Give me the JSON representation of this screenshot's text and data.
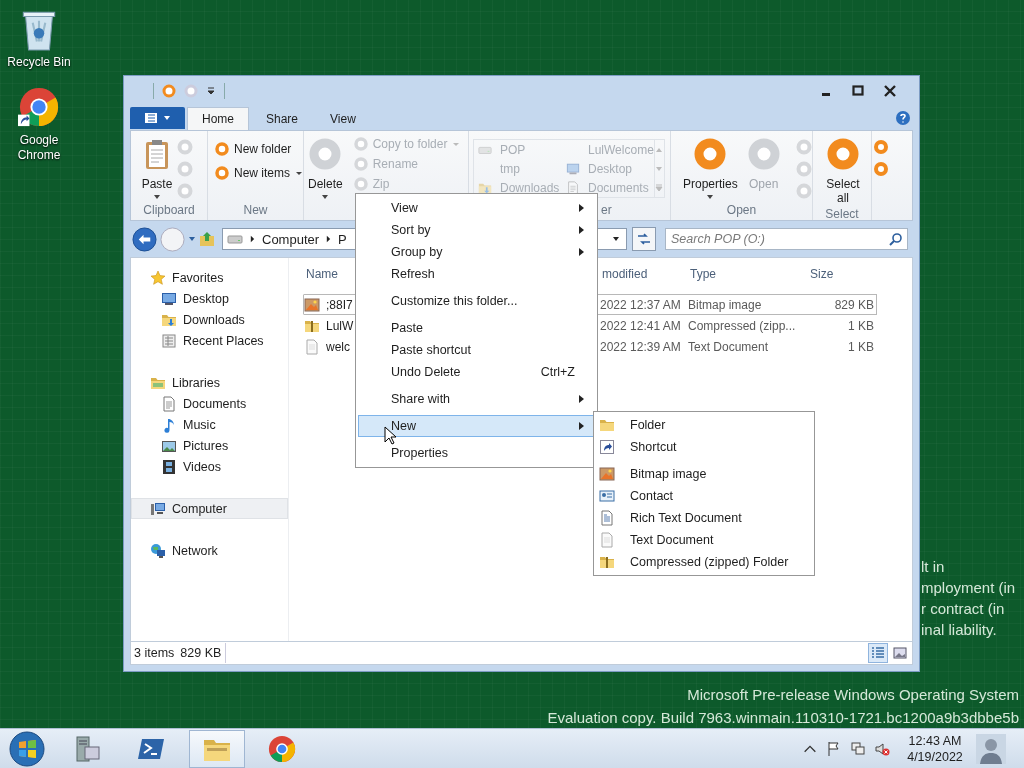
{
  "desktop": {
    "icons": [
      {
        "label": "Recycle Bin",
        "kind": "recycle"
      },
      {
        "label": "Google Chrome",
        "kind": "browser"
      }
    ],
    "notice_lines": [
      "lt in",
      "mployment (in",
      "r contract (in",
      "inal liability."
    ],
    "build_notice": [
      "Microsoft Pre-release Windows Operating System",
      "Evaluation copy. Build 7963.winmain.110310-1721.bc1200a9b3dbbe5b"
    ]
  },
  "explorer": {
    "ribbon_tabs": [
      {
        "label": "Home",
        "selected": true
      },
      {
        "label": "Share",
        "selected": false
      },
      {
        "label": "View",
        "selected": false
      }
    ],
    "ribbon": {
      "clipboard": {
        "label": "Clipboard",
        "button": "Paste"
      },
      "new": {
        "label": "New",
        "items": [
          {
            "label": "New folder",
            "dropdown": false
          },
          {
            "label": "New items",
            "dropdown": true
          }
        ]
      },
      "organize": {
        "button": "Delete",
        "items": [
          {
            "label": "Copy to folder",
            "dropdown": true,
            "disabled": true
          },
          {
            "label": "Rename",
            "dropdown": false,
            "disabled": true
          },
          {
            "label": "Zip",
            "dropdown": false,
            "disabled": true
          }
        ]
      },
      "gallery": {
        "label": "er",
        "items": [
          {
            "label": "POP",
            "kind": "drive"
          },
          {
            "label": "LulWelcome",
            "kind": "blank"
          },
          {
            "label": "tmp",
            "kind": "blank"
          },
          {
            "label": "Desktop",
            "kind": "desktop"
          },
          {
            "label": "Downloads",
            "kind": "downloads"
          },
          {
            "label": "Documents",
            "kind": "documents"
          }
        ]
      },
      "open": {
        "label": "Open",
        "buttons": [
          {
            "label": "Properties",
            "disabled": false,
            "dropdown": true
          },
          {
            "label": "Open",
            "disabled": true,
            "dropdown": false
          }
        ]
      },
      "select": {
        "label": "Select",
        "button": "Select all"
      }
    },
    "address": {
      "crumbs": [
        "Computer",
        "P"
      ],
      "search_placeholder": "Search POP (O:)"
    },
    "sidebar": [
      {
        "label": "Favorites",
        "kind": "star",
        "selected": false,
        "children": [
          {
            "label": "Desktop",
            "kind": "desktop",
            "selected": false
          },
          {
            "label": "Downloads",
            "kind": "downloads",
            "selected": false
          },
          {
            "label": "Recent Places",
            "kind": "recent",
            "selected": false
          }
        ]
      },
      {
        "label": "Libraries",
        "kind": "library",
        "selected": false,
        "children": [
          {
            "label": "Documents",
            "kind": "documents",
            "selected": false
          },
          {
            "label": "Music",
            "kind": "music",
            "selected": false
          },
          {
            "label": "Pictures",
            "kind": "pictures",
            "selected": false
          },
          {
            "label": "Videos",
            "kind": "videos",
            "selected": false
          }
        ]
      },
      {
        "label": "Computer",
        "kind": "computer",
        "selected": true
      },
      {
        "label": "Network",
        "kind": "network",
        "selected": false
      }
    ],
    "columns": [
      "Name",
      "modified",
      "Type",
      "Size"
    ],
    "files": [
      {
        "name": ";88I7",
        "kind": "bitmap",
        "modified": "2022 12:37 AM",
        "type": "Bitmap image",
        "size": "829 KB",
        "selected": true
      },
      {
        "name": "LulW",
        "kind": "zip",
        "modified": "2022 12:41 AM",
        "type": "Compressed (zipp...",
        "size": "1 KB",
        "selected": false
      },
      {
        "name": "welc",
        "kind": "text",
        "modified": "2022 12:39 AM",
        "type": "Text Document",
        "size": "1 KB",
        "selected": false
      }
    ],
    "status": {
      "count": "3 items",
      "size": "829 KB",
      "views": [
        {
          "kind": "details",
          "selected": true
        },
        {
          "kind": "large",
          "selected": false
        }
      ]
    }
  },
  "context_menu": {
    "items": [
      {
        "kind": "item",
        "label": "View",
        "submenu": true,
        "selected": false
      },
      {
        "kind": "item",
        "label": "Sort by",
        "submenu": true,
        "selected": false
      },
      {
        "kind": "item",
        "label": "Group by",
        "submenu": true,
        "selected": false
      },
      {
        "kind": "item",
        "label": "Refresh",
        "submenu": false,
        "selected": false
      },
      {
        "kind": "separator"
      },
      {
        "kind": "item",
        "label": "Customize this folder...",
        "submenu": false,
        "selected": false
      },
      {
        "kind": "separator"
      },
      {
        "kind": "item",
        "label": "Paste",
        "submenu": false,
        "selected": false
      },
      {
        "kind": "item",
        "label": "Paste shortcut",
        "submenu": false,
        "selected": false
      },
      {
        "kind": "item",
        "label": "Undo Delete",
        "shortcut": "Ctrl+Z",
        "submenu": false,
        "selected": false
      },
      {
        "kind": "separator"
      },
      {
        "kind": "item",
        "label": "Share with",
        "submenu": true,
        "selected": false
      },
      {
        "kind": "separator"
      },
      {
        "kind": "item",
        "label": "New",
        "submenu": true,
        "selected": true
      },
      {
        "kind": "separator"
      },
      {
        "kind": "item",
        "label": "Properties",
        "submenu": false,
        "selected": false
      }
    ]
  },
  "new_submenu": {
    "items": [
      {
        "kind": "folder",
        "label": "Folder"
      },
      {
        "kind": "shortcut",
        "label": "Shortcut"
      },
      {
        "kind": "separator"
      },
      {
        "kind": "bitmap",
        "label": "Bitmap image"
      },
      {
        "kind": "contact",
        "label": "Contact"
      },
      {
        "kind": "rtf",
        "label": "Rich Text Document"
      },
      {
        "kind": "text",
        "label": "Text Document"
      },
      {
        "kind": "zip",
        "label": "Compressed (zipped) Folder"
      }
    ]
  },
  "taskbar": {
    "apps": [
      {
        "kind": "server",
        "selected": false
      },
      {
        "kind": "terminal",
        "selected": false
      },
      {
        "kind": "explorer",
        "selected": true
      },
      {
        "kind": "browser",
        "selected": false
      }
    ],
    "time": "12:43 AM",
    "date": "4/19/2022"
  }
}
